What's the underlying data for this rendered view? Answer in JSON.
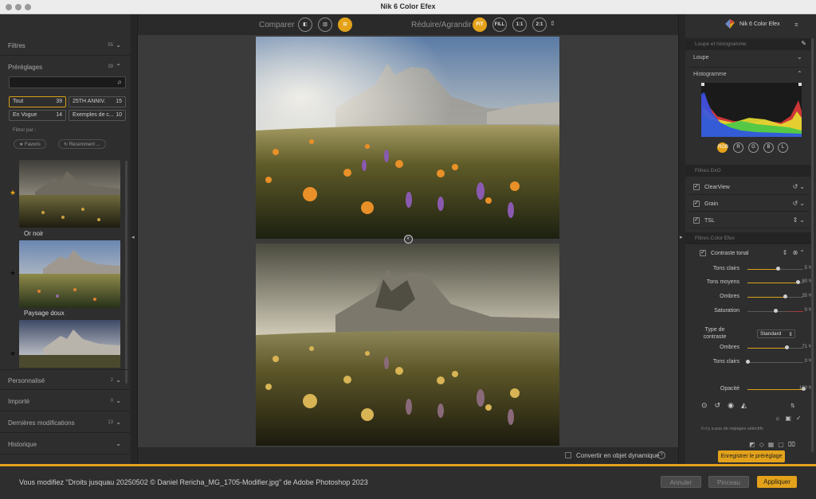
{
  "window": {
    "title": "Nik 6 Color Efex"
  },
  "left_panel": {
    "sections_top": [
      {
        "label": "Filtres",
        "count": "55"
      },
      {
        "label": "Préréglages",
        "count": "39"
      }
    ],
    "search": {
      "placeholder": ""
    },
    "chips": [
      {
        "label": "Tout",
        "count": "39"
      },
      {
        "label": "25TH ANNIV.",
        "count": "15"
      },
      {
        "label": "En Vogue",
        "count": "14"
      },
      {
        "label": "Exemples de c...",
        "count": "10"
      }
    ],
    "filter_by_label": "Filtrer par :",
    "filter_pills": [
      "★ Favoris",
      "↻ Récemment ..."
    ],
    "presets": [
      {
        "name": "Or noir"
      },
      {
        "name": "Paysage doux"
      }
    ],
    "sections_bottom": [
      {
        "label": "Personnalisé",
        "count": "2"
      },
      {
        "label": "Importé",
        "count": "0"
      },
      {
        "label": "Dernières modifications",
        "count": "13"
      },
      {
        "label": "Historique",
        "count": ""
      }
    ]
  },
  "toolbar": {
    "compare_label": "Comparer",
    "zoom_label": "Réduire/Agrandir",
    "zoom_buttons": [
      "FIT",
      "FILL",
      "1:1",
      "2:1"
    ]
  },
  "canvas_bottom": {
    "convert_label": "Convertir en objet dynamique",
    "help": "?"
  },
  "right_panel": {
    "brand": "Nik 6 Color Efex",
    "loupe_hist_header": "Loupe et histogramme",
    "loupe_label": "Loupe",
    "histogram_label": "Histogramme",
    "hist_channels": [
      "RGB",
      "R",
      "G",
      "B",
      "L"
    ],
    "dxo_header": "Filtres DxO",
    "dxo_filters": [
      "ClearView",
      "Grain",
      "TSL"
    ],
    "color_efex_header": "Filtres Color Efex",
    "active_filter": "Contraste tonal",
    "sliders_top": [
      {
        "label": "Tons clairs",
        "value": "5 %",
        "fraction": 0.55
      },
      {
        "label": "Tons moyens",
        "value": "80 %",
        "fraction": 0.9
      },
      {
        "label": "Ombres",
        "value": "35 %",
        "fraction": 0.68
      },
      {
        "label": "Saturation",
        "value": "0 %",
        "fraction": 0.5
      }
    ],
    "contrast_type_label": "Type de contraste",
    "contrast_type_value": "Standard",
    "sliders_bottom": [
      {
        "label": "Ombres",
        "value": "71 %",
        "fraction": 0.71
      },
      {
        "label": "Tons clairs",
        "value": "0 %",
        "fraction": 0.0
      }
    ],
    "opacity": {
      "label": "Opacité",
      "value": "100 %",
      "fraction": 1.0
    },
    "no_selective": "Il n'y a pas de réglages sélectifs",
    "save_preset": "Enregistrer le préréglage"
  },
  "footer": {
    "message": "Vous modifiez \"Droits jusquau 20250502 © Daniel Rericha_MG_1705-Modifier.jpg\" de Adobe Photoshop 2023",
    "cancel": "Annuler",
    "brush": "Pinceau",
    "apply": "Appliquer"
  },
  "colors": {
    "accent": "#e3a21a"
  }
}
